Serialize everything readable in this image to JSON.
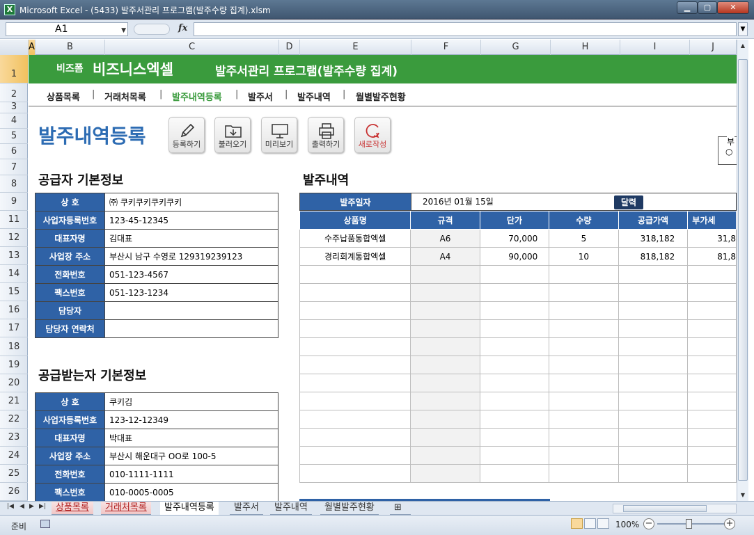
{
  "window": {
    "title": "Microsoft Excel - (5433) 발주서관리 프로그램(발주수량 집계).xlsm",
    "app_icon": "X"
  },
  "formula_bar": {
    "name_box": "A1",
    "fx": "fx",
    "formula": ""
  },
  "columns": [
    "A",
    "B",
    "C",
    "D",
    "E",
    "F",
    "G",
    "H",
    "I",
    "J"
  ],
  "rows": [
    "1",
    "2",
    "3",
    "4",
    "5",
    "6",
    "7",
    "8",
    "9",
    "11",
    "12",
    "13",
    "14",
    "15",
    "16",
    "17",
    "18",
    "19",
    "20",
    "21",
    "22",
    "23",
    "24",
    "25",
    "26"
  ],
  "banner": {
    "brand_small": "비즈폼",
    "brand_big": "비즈니스엑셀",
    "program_title": "발주서관리 프로그램(발주수량 집계)"
  },
  "nav": {
    "items": [
      {
        "label": "상품목록"
      },
      {
        "label": "거래처목록"
      },
      {
        "label": "발주내역등록"
      },
      {
        "label": "발주서"
      },
      {
        "label": "발주내역"
      },
      {
        "label": "월별발주현황"
      }
    ],
    "separator": "|"
  },
  "page_title": "발주내역등록",
  "toolbar": {
    "register": "등록하기",
    "load": "불러오기",
    "preview": "미리보기",
    "print": "출력하기",
    "new": "새로작성"
  },
  "sidebox": {
    "t1": "부",
    "t2": "○"
  },
  "supplier": {
    "title": "공급자 기본정보",
    "rows": [
      {
        "label": "상 호",
        "value": "㈜ 쿠키쿠키쿠키쿠키"
      },
      {
        "label": "사업자등록번호",
        "value": "123-45-12345"
      },
      {
        "label": "대표자명",
        "value": "김대표"
      },
      {
        "label": "사업장 주소",
        "value": "부산시 남구 수영로 129319239123"
      },
      {
        "label": "전화번호",
        "value": "051-123-4567"
      },
      {
        "label": "팩스번호",
        "value": "051-123-1234"
      },
      {
        "label": "담당자",
        "value": ""
      },
      {
        "label": "담당자 연락처",
        "value": ""
      }
    ]
  },
  "receiver": {
    "title": "공급받는자 기본정보",
    "rows": [
      {
        "label": "상 호",
        "value": "쿠키김"
      },
      {
        "label": "사업자등록번호",
        "value": "123-12-12349"
      },
      {
        "label": "대표자명",
        "value": "박대표"
      },
      {
        "label": "사업장 주소",
        "value": "부산시 해운대구 OO로 100-5"
      },
      {
        "label": "전화번호",
        "value": "010-1111-1111"
      },
      {
        "label": "팩스번호",
        "value": "010-0005-0005"
      }
    ]
  },
  "orders": {
    "title": "발주내역",
    "date_label": "발주일자",
    "date_value": "2016년 01월 15일",
    "calendar_button": "달력",
    "headers": [
      "상품명",
      "규격",
      "단가",
      "수량",
      "공급가액",
      "부가세"
    ],
    "rows": [
      [
        "수주납품통합엑셀",
        "A6",
        "70,000",
        "5",
        "318,182",
        "31,8"
      ],
      [
        "경리회계통합엑셀",
        "A4",
        "90,000",
        "10",
        "818,182",
        "81,8"
      ],
      [
        "",
        "",
        "",
        "",
        "",
        ""
      ],
      [
        "",
        "",
        "",
        "",
        "",
        ""
      ],
      [
        "",
        "",
        "",
        "",
        "",
        ""
      ],
      [
        "",
        "",
        "",
        "",
        "",
        ""
      ],
      [
        "",
        "",
        "",
        "",
        "",
        ""
      ],
      [
        "",
        "",
        "",
        "",
        "",
        ""
      ],
      [
        "",
        "",
        "",
        "",
        "",
        ""
      ],
      [
        "",
        "",
        "",
        "",
        "",
        ""
      ],
      [
        "",
        "",
        "",
        "",
        "",
        ""
      ],
      [
        "",
        "",
        "",
        "",
        "",
        ""
      ],
      [
        "",
        "",
        "",
        "",
        "",
        ""
      ],
      [
        "",
        "",
        "",
        "",
        "",
        ""
      ]
    ]
  },
  "sheet_tabs": [
    {
      "label": "상품목록",
      "style": "red"
    },
    {
      "label": "거래처목록",
      "style": "red"
    },
    {
      "label": "발주내역등록",
      "style": "active"
    },
    {
      "label": "발주서",
      "style": "normal"
    },
    {
      "label": "발주내역",
      "style": "normal"
    },
    {
      "label": "월별발주현황",
      "style": "normal"
    }
  ],
  "status": {
    "ready": "준비",
    "zoom": "100%"
  },
  "colors": {
    "banner_green": "#3a9b3d",
    "header_blue": "#2f62a6",
    "title_blue": "#2d6cb3",
    "new_red": "#c83232"
  }
}
